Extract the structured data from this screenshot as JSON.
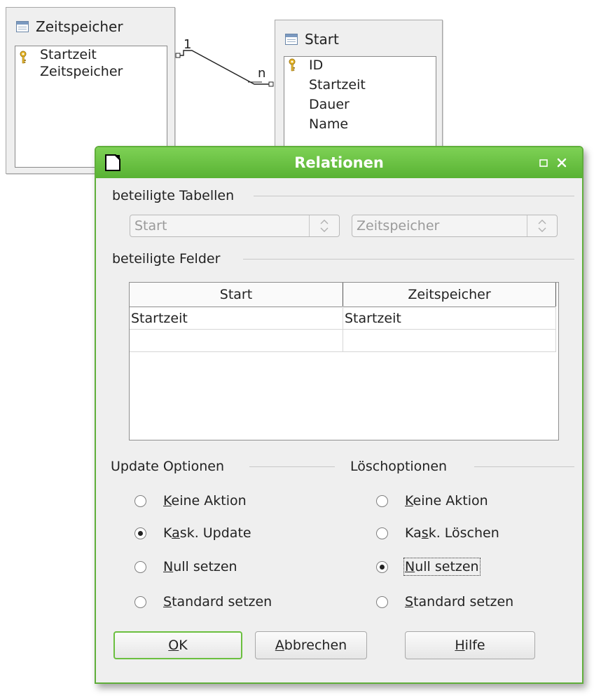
{
  "designer": {
    "tables": [
      {
        "title": "Zeitspeicher",
        "fields": [
          "Startzeit",
          "Zeitspeicher"
        ],
        "key_field": "Startzeit"
      },
      {
        "title": "Start",
        "fields": [
          "ID",
          "Startzeit",
          "Dauer",
          "Name"
        ],
        "key_field": "ID"
      }
    ],
    "relation": {
      "left_cardinality": "1",
      "right_cardinality": "n"
    }
  },
  "dialog": {
    "title": "Relationen",
    "tables_section": "beteiligte Tabellen",
    "table_combo_1": "Start",
    "table_combo_2": "Zeitspeicher",
    "fields_section": "beteiligte Felder",
    "fields_grid": {
      "columns": [
        "Start",
        "Zeitspeicher"
      ],
      "rows": [
        [
          "Startzeit",
          "Startzeit"
        ],
        [
          "",
          ""
        ]
      ]
    },
    "update_options": {
      "label": "Update Optionen",
      "options": [
        {
          "pre": "",
          "u": "K",
          "post": "eine Aktion",
          "selected": false
        },
        {
          "pre": "K",
          "u": "a",
          "post": "sk. Update",
          "selected": true
        },
        {
          "pre": "",
          "u": "N",
          "post": "ull setzen",
          "selected": false
        },
        {
          "pre": "",
          "u": "S",
          "post": "tandard setzen",
          "selected": false
        }
      ]
    },
    "delete_options": {
      "label": "Löschoptionen",
      "options": [
        {
          "pre": "",
          "u": "K",
          "post": "eine Aktion",
          "selected": false
        },
        {
          "pre": "Ka",
          "u": "s",
          "post": "k. Löschen",
          "selected": false
        },
        {
          "pre": "",
          "u": "N",
          "post": "ull setzen",
          "selected": true
        },
        {
          "pre": "",
          "u": "S",
          "post": "tandard setzen",
          "selected": false
        }
      ]
    },
    "buttons": {
      "ok": {
        "pre": "",
        "u": "O",
        "post": "K"
      },
      "cancel": {
        "pre": "",
        "u": "A",
        "post": "bbrechen"
      },
      "help": {
        "pre": "",
        "u": "H",
        "post": "ilfe"
      }
    },
    "colors": {
      "title_bar": "#5fae3a",
      "title_text": "#ffffff",
      "default_button_border": "#6bbf3f"
    }
  }
}
